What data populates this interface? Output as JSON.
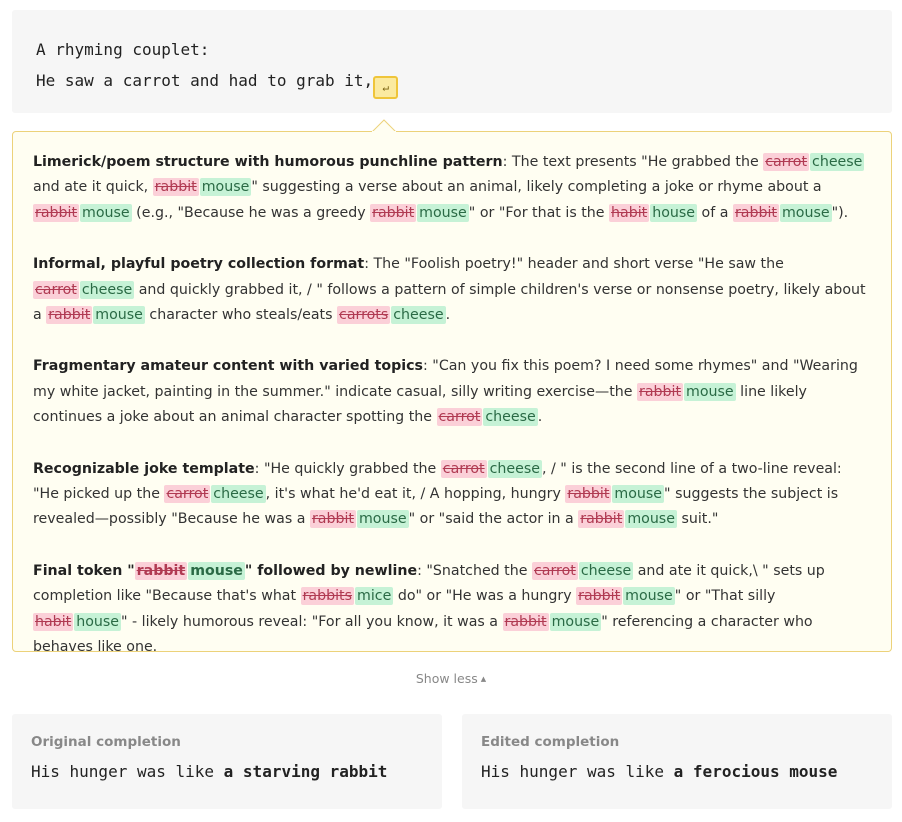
{
  "prompt": {
    "line1": "A rhyming couplet:",
    "line2": "He saw a carrot and had to grab it,",
    "newline_glyph": "↵"
  },
  "explanations": [
    {
      "heading": "Limerick/poem structure with humorous punchline pattern",
      "segments": [
        {
          "t": ": The text presents \"He grabbed the "
        },
        {
          "old": "carrot",
          "new": "cheese"
        },
        {
          "t": " and ate it quick, "
        },
        {
          "old": "rabbit",
          "new": "mouse"
        },
        {
          "t": "\" suggesting a verse about an animal, likely completing a joke or rhyme about a "
        },
        {
          "old": "rabbit",
          "new": "mouse"
        },
        {
          "t": " (e.g., \"Because he was a greedy "
        },
        {
          "old": "rabbit",
          "new": "mouse"
        },
        {
          "t": "\" or \"For that is the "
        },
        {
          "old": "habit",
          "new": "house"
        },
        {
          "t": " of a "
        },
        {
          "old": "rabbit",
          "new": "mouse"
        },
        {
          "t": "\")."
        }
      ]
    },
    {
      "heading": "Informal, playful poetry collection format",
      "segments": [
        {
          "t": ": The \"Foolish poetry!\" header and short verse \"He saw the "
        },
        {
          "old": "carrot",
          "new": "cheese"
        },
        {
          "t": " and quickly grabbed it, / \" follows a pattern of simple children's verse or nonsense poetry, likely about a "
        },
        {
          "old": "rabbit",
          "new": "mouse"
        },
        {
          "t": " character who steals/eats "
        },
        {
          "old": "carrots",
          "new": "cheese"
        },
        {
          "t": "."
        }
      ]
    },
    {
      "heading": "Fragmentary amateur content with varied topics",
      "segments": [
        {
          "t": ": \"Can you fix this poem? I need some rhymes\" and \"Wearing my white jacket, painting in the summer.\" indicate casual, silly writing exercise—the "
        },
        {
          "old": "rabbit",
          "new": "mouse"
        },
        {
          "t": " line likely continues a joke about an animal character spotting the "
        },
        {
          "old": "carrot",
          "new": "cheese"
        },
        {
          "t": "."
        }
      ]
    },
    {
      "heading": "Recognizable joke template",
      "segments": [
        {
          "t": ": \"He quickly grabbed the "
        },
        {
          "old": "carrot",
          "new": "cheese"
        },
        {
          "t": ", / \" is the second line of a two-line reveal: \"He picked up the "
        },
        {
          "old": "carrot",
          "new": "cheese"
        },
        {
          "t": ", it's what he'd eat it, / A hopping, hungry "
        },
        {
          "old": "rabbit",
          "new": "mouse"
        },
        {
          "t": "\" suggests the subject is revealed—possibly \"Because he was a "
        },
        {
          "old": "rabbit",
          "new": "mouse"
        },
        {
          "t": "\" or \"said the actor in a "
        },
        {
          "old": "rabbit",
          "new": "mouse"
        },
        {
          "t": " suit.\""
        }
      ]
    },
    {
      "heading": "Final token \"",
      "heading_old": "rabbit",
      "heading_new": "mouse",
      "heading_tail": "\" followed by newline",
      "segments": [
        {
          "t": ": \"Snatched the "
        },
        {
          "old": "carrot",
          "new": "cheese"
        },
        {
          "t": " and ate it quick,\\ \" sets up completion like \"Because that's what "
        },
        {
          "old": "rabbits",
          "new": "mice"
        },
        {
          "t": " do\" or \"He was a hungry "
        },
        {
          "old": "rabbit",
          "new": "mouse"
        },
        {
          "t": "\" or \"That silly "
        },
        {
          "old": "habit",
          "new": "house"
        },
        {
          "t": "\" - likely humorous reveal: \"For all you know, it was a "
        },
        {
          "old": "rabbit",
          "new": "mouse"
        },
        {
          "t": "\" referencing a character who behaves like one."
        }
      ]
    }
  ],
  "toggle": {
    "label": "Show less",
    "caret": "▲"
  },
  "original": {
    "title": "Original completion",
    "prefix": "His hunger was like ",
    "emphasis": "a starving rabbit"
  },
  "edited": {
    "title": "Edited completion",
    "prefix": "His hunger was like ",
    "emphasis": "a ferocious mouse"
  },
  "colors": {
    "old_bg": "#fbd0d8",
    "new_bg": "#c6f2d6",
    "panel_border": "#ecd27a",
    "token_bg": "#fbeaa0"
  }
}
